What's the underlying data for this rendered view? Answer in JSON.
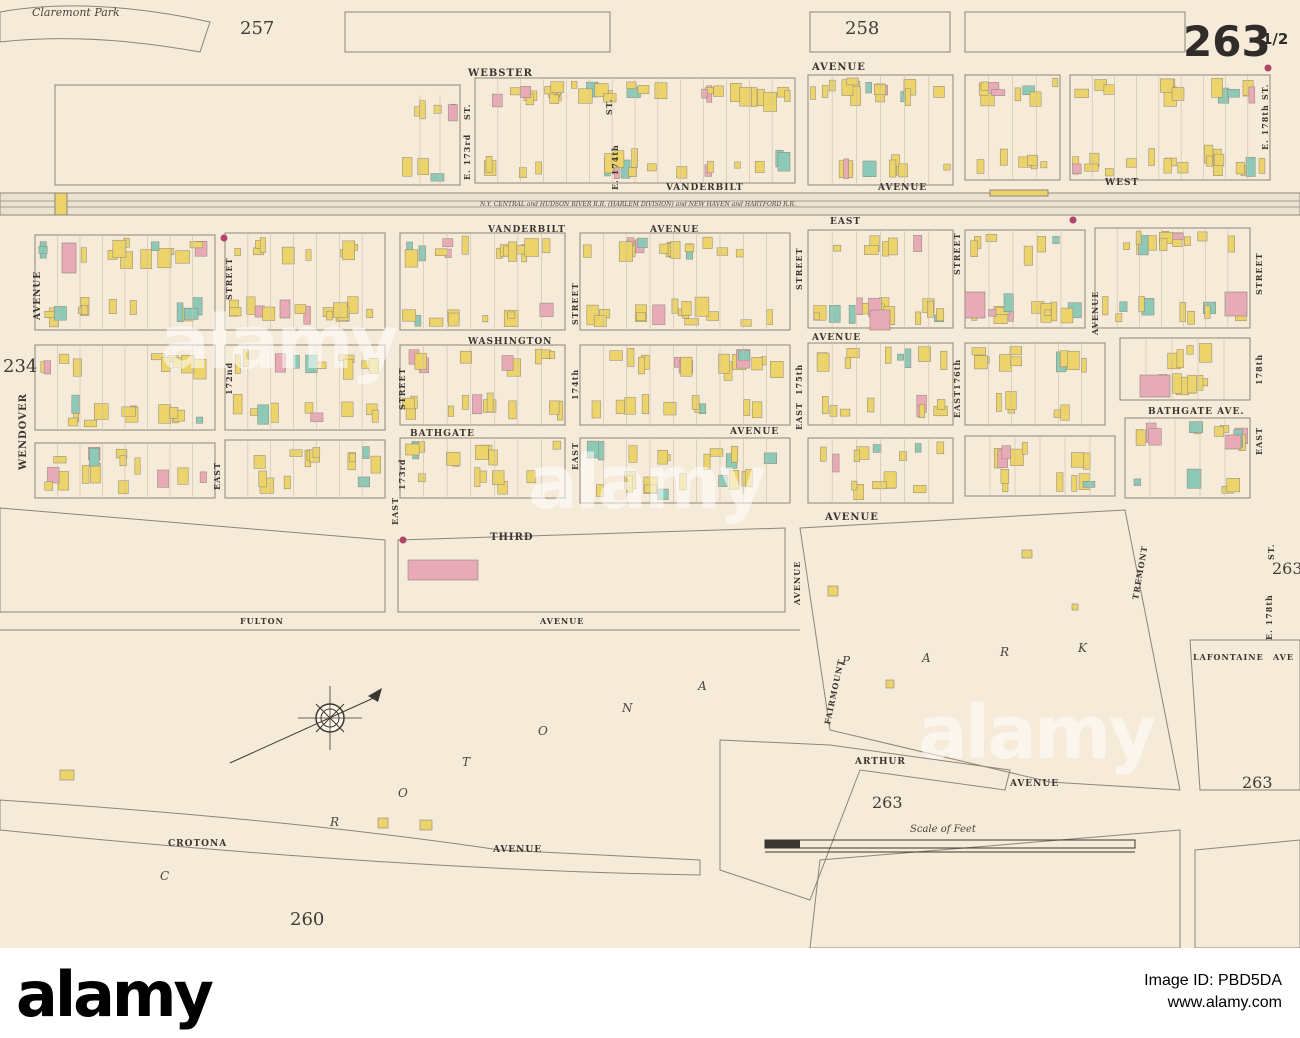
{
  "map": {
    "sheet_number_main": "263",
    "sheet_number_fraction": "1/2",
    "adjacent_sheets": {
      "top_left": "257",
      "top_mid": "258",
      "left": "234",
      "right_mid": "263",
      "bottom_mid": "263",
      "bottom_right": "263",
      "bottom_left": "260"
    },
    "park_name_top": "Claremont Park",
    "streets": {
      "webster": "WEBSTER",
      "avenue": "AVENUE",
      "vanderbilt": "VANDERBILT",
      "west": "WEST",
      "east": "EAST",
      "washington": "WASHINGTON",
      "bathgate": "BATHGATE",
      "bathgate_ave": "BATHGATE  AVE.",
      "third": "THIRD",
      "fulton": "FULTON",
      "crotona": "CROTONA",
      "arthur": "ARTHUR",
      "lafontaine": "LAFONTAINE",
      "ave_short": "AVE",
      "fairmount": "FAIRMOUNT",
      "tremont": "TREMONT",
      "wendover": "WENDOVER",
      "street": "STREET",
      "st_172": "172nd",
      "st_173": "173rd",
      "st_174": "174th",
      "st_175": "175th",
      "st_176": "176th",
      "st_178": "178th",
      "e173": "E. 173rd",
      "st": "ST.",
      "e174": "E. 174th",
      "e178": "E. 178th"
    },
    "railroad_label": "N.Y. CENTRAL and HUDSON RIVER R.R. (HARLEM DIVISION) and NEW HAVEN and HARTFORD R.R.",
    "park_letters": [
      "C",
      "R",
      "O",
      "T",
      "O",
      "N",
      "A",
      "P",
      "A",
      "R",
      "K"
    ],
    "scale_caption": "Scale of Feet",
    "colors": {
      "paper": "#f6ead8",
      "frame_building": "#ecd36a",
      "brick_building": "#e9aab8",
      "stone_building": "#8cc9b7",
      "line": "#8d8579"
    }
  },
  "watermark": {
    "text": "alamy"
  },
  "footer": {
    "logo": "alamy",
    "image_id": "Image ID: PBD5DA",
    "url": "www.alamy.com"
  }
}
